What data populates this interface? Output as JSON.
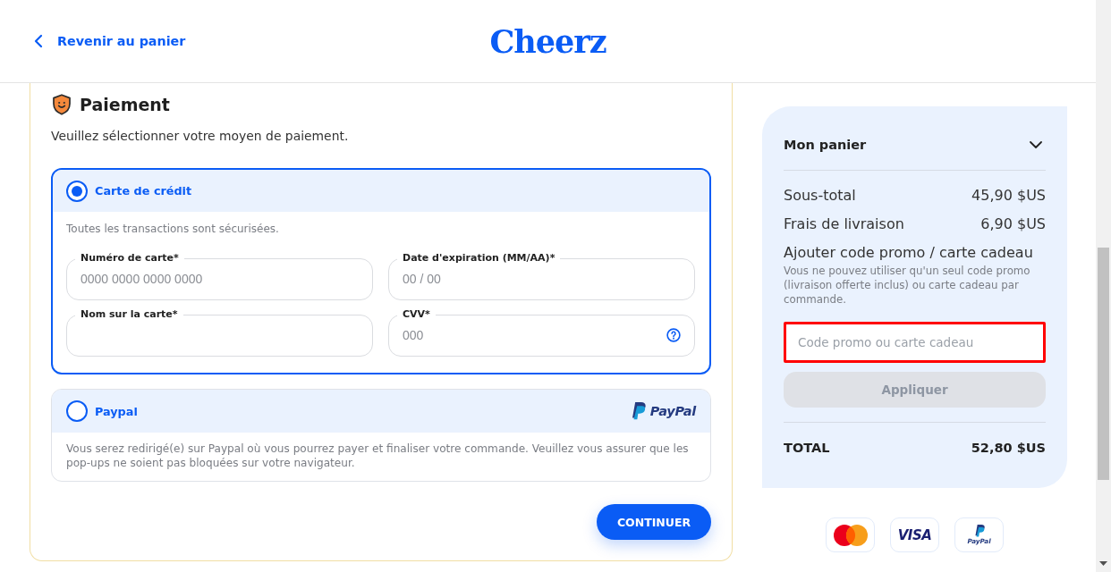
{
  "header": {
    "back_link": "Revenir au panier",
    "logo": "Cheerz"
  },
  "payment": {
    "title": "Paiement",
    "subtitle": "Veuillez sélectionner votre moyen de paiement.",
    "methods": [
      {
        "kind": "card",
        "label": "Carte de crédit",
        "selected": true,
        "note": "Toutes les transactions sont sécurisées.",
        "fields": [
          {
            "label": "Numéro de carte*",
            "placeholder": "0000 0000 0000 0000",
            "help": false
          },
          {
            "label": "Date d'expiration (MM/AA)*",
            "placeholder": "00 / 00",
            "help": false
          },
          {
            "label": "Nom sur la carte*",
            "help": false
          },
          {
            "label": "CVV*",
            "placeholder": "000",
            "help": true
          }
        ]
      },
      {
        "kind": "paypal",
        "label": "Paypal",
        "selected": false,
        "logo_text": "PayPal",
        "note": "Vous serez redirigé(e) sur Paypal où vous pourrez payer et finaliser votre commande. Veuillez vous assurer que les pop-ups ne soient pas bloquées sur votre navigateur."
      }
    ],
    "continue_button": "CONTINUER"
  },
  "cart": {
    "title": "Mon panier",
    "expanded": false,
    "rows": [
      {
        "label": "Sous-total",
        "value": "45,90 $US"
      },
      {
        "label": "Frais de livraison",
        "value": "6,90 $US"
      }
    ],
    "promo": {
      "title": "Ajouter code promo / carte cadeau",
      "note": "Vous ne pouvez utiliser qu'un seul code promo (livraison offerte inclus) ou carte cadeau par commande.",
      "placeholder": "Code promo ou carte cadeau",
      "highlighted": true
    },
    "apply_button": {
      "label": "Appliquer",
      "disabled": true
    },
    "total": {
      "label": "TOTAL",
      "value": "52,80 $US"
    }
  },
  "accepted_payments": [
    {
      "kind": "mastercard"
    },
    {
      "kind": "visa",
      "label": "VISA"
    },
    {
      "kind": "paypal",
      "label": "PayPal"
    }
  ]
}
